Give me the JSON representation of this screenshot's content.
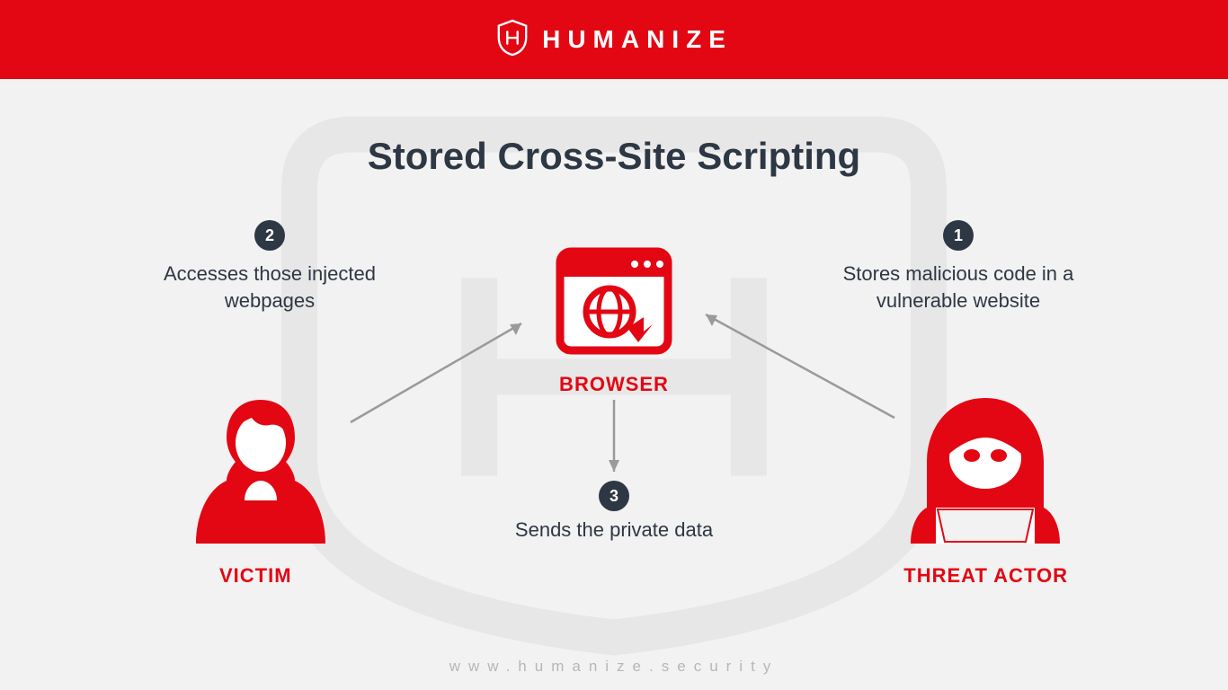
{
  "header": {
    "brand": "HUMANIZE"
  },
  "title": "Stored Cross-Site Scripting",
  "steps": [
    {
      "num": "1",
      "desc": "Stores malicious code in a vulnerable website"
    },
    {
      "num": "2",
      "desc": "Accesses those injected webpages"
    },
    {
      "num": "3",
      "desc": "Sends the private data"
    }
  ],
  "roles": {
    "victim": "VICTIM",
    "browser": "BROWSER",
    "threat": "THREAT ACTOR"
  },
  "footer": "www.humanize.security",
  "colors": {
    "accent": "#e30713",
    "dark": "#2e3744",
    "bg": "#f2f2f2"
  }
}
